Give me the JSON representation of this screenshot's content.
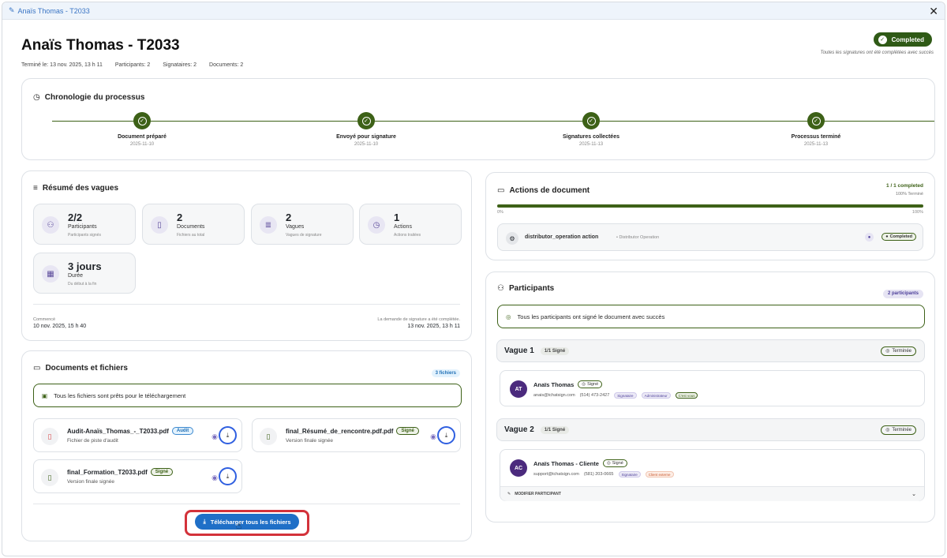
{
  "window": {
    "title": "Anaïs Thomas - T2033"
  },
  "header": {
    "title": "Anaïs Thomas - T2033",
    "meta": [
      "Terminé le: 13 nov. 2025, 13 h 11",
      "Participants: 2",
      "Signataires: 2",
      "Documents: 2"
    ],
    "status": "Completed",
    "status_sub": "Toutes les signatures ont été complétées avec succès"
  },
  "timeline": {
    "title": "Chronologie du processus",
    "steps": [
      {
        "label": "Document préparé",
        "date": "2025-11-10"
      },
      {
        "label": "Envoyé pour signature",
        "date": "2025-11-10"
      },
      {
        "label": "Signatures collectées",
        "date": "2025-11-13"
      },
      {
        "label": "Processus terminé",
        "date": "2025-11-13"
      }
    ]
  },
  "summary": {
    "title": "Résumé des vagues",
    "stats": [
      {
        "value": "2/2",
        "name": "Participants",
        "sub": "Participants signés",
        "icon": "users-icon"
      },
      {
        "value": "2",
        "name": "Documents",
        "sub": "Fichiers au total",
        "icon": "file-icon"
      },
      {
        "value": "2",
        "name": "Vagues",
        "sub": "Vagues de signature",
        "icon": "list-icon"
      },
      {
        "value": "1",
        "name": "Actions",
        "sub": "Actions traitées",
        "icon": "clock-icon"
      },
      {
        "value": "3 jours",
        "name": "Durée",
        "sub": "Du début à la fin",
        "icon": "calendar-icon"
      }
    ],
    "start_label": "Commencé",
    "start_date": "10 nov. 2025, 15 h 40",
    "end_label": "La demande de signature a été complétée.",
    "end_date": "13 nov. 2025, 13 h 11"
  },
  "documents": {
    "title": "Documents et fichiers",
    "count": "3 fichiers",
    "alert": "Tous les fichiers sont prêts pour le téléchargement",
    "files": [
      {
        "name": "Audit-Anaïs_Thomas_-_T2033.pdf",
        "badge": "Audit",
        "sub": "Fichier de piste d'audit"
      },
      {
        "name": "final_Résumé_de_rencontre.pdf.pdf",
        "badge": "Signé",
        "sub": "Version finale signée"
      },
      {
        "name": "final_Formation_T2033.pdf",
        "badge": "Signé",
        "sub": "Version finale signée"
      }
    ],
    "download_all": "Télécharger tous les fichiers"
  },
  "actions": {
    "title": "Actions de document",
    "completed": "1 / 1 completed",
    "percent_label": "100% Terminé",
    "progress": 1.0,
    "min": "0%",
    "max": "100%",
    "item": {
      "name": "distributor_operation action",
      "sub": "• Distributor Operation",
      "status": "Completed"
    }
  },
  "participants": {
    "title": "Participants",
    "count": "2 participants",
    "alert": "Tous les participants ont signé le document avec succès",
    "waves": [
      {
        "label": "Vague 1",
        "signed": "1/1 Signé",
        "status": "Terminée",
        "people": [
          {
            "initials": "AT",
            "name": "Anaïs Thomas",
            "status": "Signé",
            "email": "anais@tchatsign.com",
            "phone": "(514) 473-2427",
            "tags": [
              "Signataire",
              "Administrateur",
              "C'est vous"
            ]
          }
        ]
      },
      {
        "label": "Vague 2",
        "signed": "1/1 Signé",
        "status": "Terminée",
        "people": [
          {
            "initials": "AC",
            "name": "Anaïs Thomas - Cliente",
            "status": "Signé",
            "email": "support@tchatsign.com",
            "phone": "(581) 203-0665",
            "tags": [
              "Signataire",
              "Client externe"
            ],
            "edit": "MODIFIER PARTICIPANT"
          }
        ]
      }
    ]
  },
  "colors": {
    "accent": "#3d6117",
    "primary": "#1f6fc7",
    "highlight": "#d3323a"
  }
}
